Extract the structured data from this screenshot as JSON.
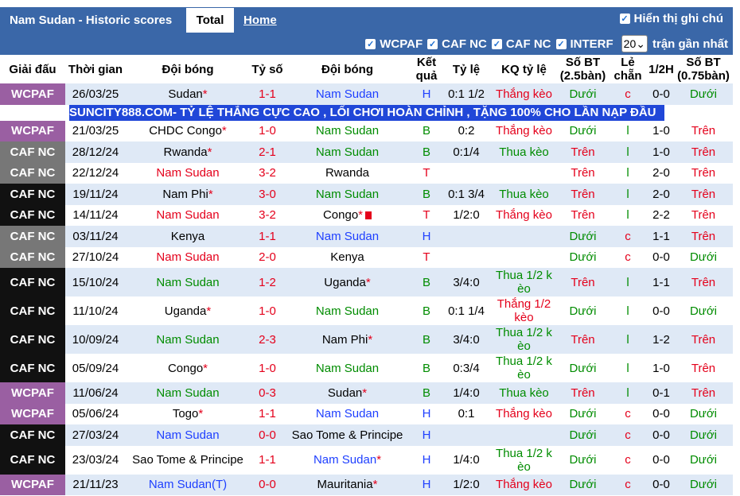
{
  "header": {
    "title": "Nam Sudan - Historic scores",
    "tab_total": "Total",
    "tab_home": "Home",
    "show_odds": "Hiển thị ghi chú"
  },
  "filters": {
    "items": [
      "WCPAF",
      "CAF NC",
      "CAF NC",
      "INTERF"
    ],
    "count": "20",
    "recent_label": "trận gần nhất"
  },
  "columns": [
    "Giải đấu",
    "Thời gian",
    "Đội bóng",
    "Tỷ số",
    "Đội bóng",
    "Kết quả",
    "Tỷ lệ",
    "KQ tỷ lệ",
    "Số BT (2.5bàn)",
    "Lẻ chẵn",
    "1/2H",
    "Số BT (0.75bàn)"
  ],
  "ad": "SUNCITY888.COM- TỶ LỆ THẮNG CỰC CAO , LỐI CHƠI HOÀN CHỈNH , TẶNG 100% CHO LẦN NẠP ĐẦU",
  "rows": [
    {
      "league": "WCPAF",
      "lc": "wc",
      "date": "26/03/25",
      "home": "Sudan",
      "hc": "",
      "hs": true,
      "score": "1-1",
      "away": "Nam Sudan",
      "ac": "blue",
      "as": false,
      "res": "H",
      "rc": "blue",
      "odds": "0:1 1/2",
      "kq": "Thắng kèo",
      "kc": "red",
      "bt": "Dưới",
      "btc": "green",
      "lec": "c",
      "lecc": "red",
      "half": "0-0",
      "bt2": "Dưới",
      "bt2c": "green",
      "tall": false
    },
    {
      "league": "WCPAF",
      "lc": "wc",
      "date": "21/03/25",
      "home": "CHDC Congo",
      "hc": "",
      "hs": true,
      "score": "1-0",
      "away": "Nam Sudan",
      "ac": "green",
      "as": false,
      "res": "B",
      "rc": "green",
      "odds": "0:2",
      "kq": "Thắng kèo",
      "kc": "red",
      "bt": "Dưới",
      "btc": "green",
      "lec": "l",
      "lecc": "green",
      "half": "1-0",
      "bt2": "Trên",
      "bt2c": "red",
      "tall": false
    },
    {
      "league": "CAF NC",
      "lc": "cafa",
      "date": "28/12/24",
      "home": "Rwanda",
      "hc": "",
      "hs": true,
      "score": "2-1",
      "away": "Nam Sudan",
      "ac": "green",
      "as": false,
      "res": "B",
      "rc": "green",
      "odds": "0:1/4",
      "kq": "Thua kèo",
      "kc": "green",
      "bt": "Trên",
      "btc": "red",
      "lec": "l",
      "lecc": "green",
      "half": "1-0",
      "bt2": "Trên",
      "bt2c": "red",
      "tall": false
    },
    {
      "league": "CAF NC",
      "lc": "cafa",
      "date": "22/12/24",
      "home": "Nam Sudan",
      "hc": "red",
      "hs": false,
      "score": "3-2",
      "away": "Rwanda",
      "ac": "",
      "as": false,
      "res": "T",
      "rc": "red",
      "odds": "",
      "kq": "",
      "kc": "",
      "bt": "Trên",
      "btc": "red",
      "lec": "l",
      "lecc": "green",
      "half": "2-0",
      "bt2": "Trên",
      "bt2c": "red",
      "tall": false
    },
    {
      "league": "CAF NC",
      "lc": "cafb",
      "date": "19/11/24",
      "home": "Nam Phi",
      "hc": "",
      "hs": true,
      "score": "3-0",
      "away": "Nam Sudan",
      "ac": "green",
      "as": false,
      "res": "B",
      "rc": "green",
      "odds": "0:1 3/4",
      "kq": "Thua kèo",
      "kc": "green",
      "bt": "Trên",
      "btc": "red",
      "lec": "l",
      "lecc": "green",
      "half": "2-0",
      "bt2": "Trên",
      "bt2c": "red",
      "tall": false
    },
    {
      "league": "CAF NC",
      "lc": "cafb",
      "date": "14/11/24",
      "home": "Nam Sudan",
      "hc": "red",
      "hs": false,
      "score": "3-2",
      "away": "Congo",
      "ac": "",
      "as": true,
      "card": true,
      "res": "T",
      "rc": "red",
      "odds": "1/2:0",
      "kq": "Thắng kèo",
      "kc": "red",
      "bt": "Trên",
      "btc": "red",
      "lec": "l",
      "lecc": "green",
      "half": "2-2",
      "bt2": "Trên",
      "bt2c": "red",
      "tall": false
    },
    {
      "league": "CAF NC",
      "lc": "cafa",
      "date": "03/11/24",
      "home": "Kenya",
      "hc": "",
      "hs": false,
      "score": "1-1",
      "away": "Nam Sudan",
      "ac": "blue",
      "as": false,
      "res": "H",
      "rc": "blue",
      "odds": "",
      "kq": "",
      "kc": "",
      "bt": "Dưới",
      "btc": "green",
      "lec": "c",
      "lecc": "red",
      "half": "1-1",
      "bt2": "Trên",
      "bt2c": "red",
      "tall": false
    },
    {
      "league": "CAF NC",
      "lc": "cafa",
      "date": "27/10/24",
      "home": "Nam Sudan",
      "hc": "red",
      "hs": false,
      "score": "2-0",
      "away": "Kenya",
      "ac": "",
      "as": false,
      "res": "T",
      "rc": "red",
      "odds": "",
      "kq": "",
      "kc": "",
      "bt": "Dưới",
      "btc": "green",
      "lec": "c",
      "lecc": "red",
      "half": "0-0",
      "bt2": "Dưới",
      "bt2c": "green",
      "tall": false
    },
    {
      "league": "CAF NC",
      "lc": "cafb",
      "date": "15/10/24",
      "home": "Nam Sudan",
      "hc": "green",
      "hs": false,
      "score": "1-2",
      "away": "Uganda",
      "ac": "",
      "as": true,
      "res": "B",
      "rc": "green",
      "odds": "3/4:0",
      "kq": "Thua 1/2 k èo",
      "kc": "green",
      "bt": "Trên",
      "btc": "red",
      "lec": "l",
      "lecc": "green",
      "half": "1-1",
      "bt2": "Trên",
      "bt2c": "red",
      "tall": true
    },
    {
      "league": "CAF NC",
      "lc": "cafb",
      "date": "11/10/24",
      "home": "Uganda",
      "hc": "",
      "hs": true,
      "score": "1-0",
      "away": "Nam Sudan",
      "ac": "green",
      "as": false,
      "res": "B",
      "rc": "green",
      "odds": "0:1 1/4",
      "kq": "Thắng 1/2 kèo",
      "kc": "red",
      "bt": "Dưới",
      "btc": "green",
      "lec": "l",
      "lecc": "green",
      "half": "0-0",
      "bt2": "Dưới",
      "bt2c": "green",
      "tall": true
    },
    {
      "league": "CAF NC",
      "lc": "cafb",
      "date": "10/09/24",
      "home": "Nam Sudan",
      "hc": "green",
      "hs": false,
      "score": "2-3",
      "away": "Nam Phi",
      "ac": "",
      "as": true,
      "res": "B",
      "rc": "green",
      "odds": "3/4:0",
      "kq": "Thua 1/2 k èo",
      "kc": "green",
      "bt": "Trên",
      "btc": "red",
      "lec": "l",
      "lecc": "green",
      "half": "1-2",
      "bt2": "Trên",
      "bt2c": "red",
      "tall": true
    },
    {
      "league": "CAF NC",
      "lc": "cafb",
      "date": "05/09/24",
      "home": "Congo",
      "hc": "",
      "hs": true,
      "score": "1-0",
      "away": "Nam Sudan",
      "ac": "green",
      "as": false,
      "res": "B",
      "rc": "green",
      "odds": "0:3/4",
      "kq": "Thua 1/2 k èo",
      "kc": "green",
      "bt": "Dưới",
      "btc": "green",
      "lec": "l",
      "lecc": "green",
      "half": "1-0",
      "bt2": "Trên",
      "bt2c": "red",
      "tall": true
    },
    {
      "league": "WCPAF",
      "lc": "wc",
      "date": "11/06/24",
      "home": "Nam Sudan",
      "hc": "green",
      "hs": false,
      "score": "0-3",
      "away": "Sudan",
      "ac": "",
      "as": true,
      "res": "B",
      "rc": "green",
      "odds": "1/4:0",
      "kq": "Thua kèo",
      "kc": "green",
      "bt": "Trên",
      "btc": "red",
      "lec": "l",
      "lecc": "green",
      "half": "0-1",
      "bt2": "Trên",
      "bt2c": "red",
      "tall": false
    },
    {
      "league": "WCPAF",
      "lc": "wc",
      "date": "05/06/24",
      "home": "Togo",
      "hc": "",
      "hs": true,
      "score": "1-1",
      "away": "Nam Sudan",
      "ac": "blue",
      "as": false,
      "res": "H",
      "rc": "blue",
      "odds": "0:1",
      "kq": "Thắng kèo",
      "kc": "red",
      "bt": "Dưới",
      "btc": "green",
      "lec": "c",
      "lecc": "red",
      "half": "0-0",
      "bt2": "Dưới",
      "bt2c": "green",
      "tall": false
    },
    {
      "league": "CAF NC",
      "lc": "cafb",
      "date": "27/03/24",
      "home": "Nam Sudan",
      "hc": "blue",
      "hs": false,
      "score": "0-0",
      "away": "Sao Tome & Principe",
      "ac": "",
      "as": false,
      "res": "H",
      "rc": "blue",
      "odds": "",
      "kq": "",
      "kc": "",
      "bt": "Dưới",
      "btc": "green",
      "lec": "c",
      "lecc": "red",
      "half": "0-0",
      "bt2": "Dưới",
      "bt2c": "green",
      "tall": false
    },
    {
      "league": "CAF NC",
      "lc": "cafb",
      "date": "23/03/24",
      "home": "Sao Tome & Principe",
      "hc": "",
      "hs": false,
      "score": "1-1",
      "away": "Nam Sudan",
      "ac": "blue",
      "as": true,
      "res": "H",
      "rc": "blue",
      "odds": "1/4:0",
      "kq": "Thua 1/2 k èo",
      "kc": "green",
      "bt": "Dưới",
      "btc": "green",
      "lec": "c",
      "lecc": "red",
      "half": "0-0",
      "bt2": "Dưới",
      "bt2c": "green",
      "tall": true
    },
    {
      "league": "WCPAF",
      "lc": "wc",
      "date": "21/11/23",
      "home": "Nam Sudan(T)",
      "hc": "blue",
      "hs": false,
      "score": "0-0",
      "away": "Mauritania",
      "ac": "",
      "as": true,
      "res": "H",
      "rc": "blue",
      "odds": "1/2:0",
      "kq": "Thắng kèo",
      "kc": "red",
      "bt": "Dưới",
      "btc": "green",
      "lec": "c",
      "lecc": "red",
      "half": "0-0",
      "bt2": "Dưới",
      "bt2c": "green",
      "tall": false
    }
  ]
}
